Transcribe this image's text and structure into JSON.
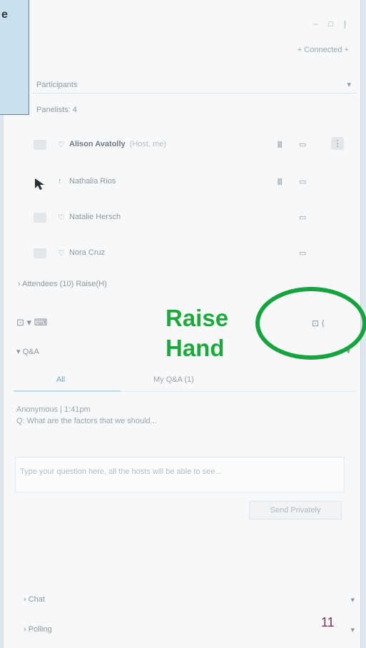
{
  "callout": {
    "text": "e"
  },
  "window": {
    "controls": [
      "–",
      "□",
      "|"
    ],
    "link": "+ Connected +"
  },
  "participants_section": {
    "label": "Participants",
    "chevron": "▾"
  },
  "panelists_header": "Panelists: 4",
  "participants": [
    {
      "name": "Alison Avatolly",
      "suffix": "(Host, me)",
      "mic": "𝍫",
      "cam": "▭",
      "more": "⋮",
      "status_icon": "♡",
      "dark": true
    },
    {
      "name": "Nathalia Rios",
      "mic": "𝍫",
      "cam": "▭",
      "status_icon": "↑",
      "dark": false
    },
    {
      "name": "Natalie Hersch",
      "cam": "▭",
      "status_icon": "♡",
      "dark": false
    },
    {
      "name": "Nora Cruz",
      "cam": "▭",
      "status_icon": "♡",
      "dark": false
    }
  ],
  "attendees_header": "› Attendees (10) Raise(H)",
  "controls": {
    "left": "⊡ ▾  ⌨",
    "right": "⊡ ⟨"
  },
  "qa_section": {
    "label": "▾ Q&A",
    "chevron": "▾"
  },
  "tabs": [
    {
      "label": "All",
      "active": true
    },
    {
      "label": "My Q&A (1)",
      "active": false
    }
  ],
  "qa_content": {
    "line1": "Anonymous | 1:41pm",
    "line2": "Q: What are the factors that we should...",
    "placeholder": "Type your question here, all the hosts will be able to see..."
  },
  "send_button": "Send Privately",
  "bottom_sections": [
    {
      "label": "› Chat",
      "chevron": "▾"
    },
    {
      "label": "› Polling",
      "chevron": "▾"
    }
  ],
  "annotation": {
    "line1": "Raise",
    "line2": "Hand"
  },
  "page_number": "11",
  "colors": {
    "accent_green": "#17a33f",
    "page_number": "#7c2d5a",
    "callout_bg": "#c9e1ee"
  }
}
